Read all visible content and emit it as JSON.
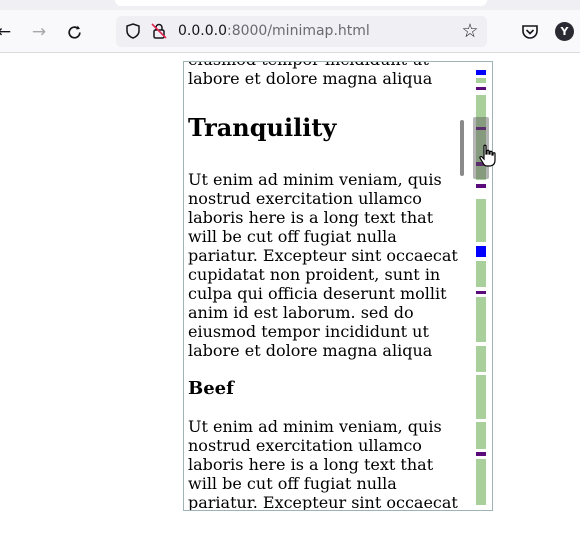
{
  "browser": {
    "url_host": "0.0.0.0",
    "url_rest": ":8000/minimap.html",
    "back_icon": "back-arrow-icon",
    "forward_icon": "forward-arrow-icon",
    "reload_icon": "reload-icon",
    "profile_initial": "Y"
  },
  "content": {
    "para_top_1": "eiusmod tempor incididunt ut",
    "para_top_2": "labore et dolore magna aliqua",
    "heading_1": "Tranquility",
    "para_1": "Ut enim ad minim veniam, quis nostrud exercitation ullamco laboris here is a long text that will be cut off fugiat nulla pariatur. Excepteur sint occaecat cupidatat non proident, sunt in culpa qui officia deserunt mollit anim id est laborum. sed do eiusmod tempor incididunt ut labore et dolore magna aliqua",
    "heading_2": "Beef",
    "para_2": "Ut enim ad minim veniam, quis nostrud exercitation ullamco laboris here is a long text that will be cut off fugiat nulla pariatur. Excepteur sint occaecat"
  },
  "minimap": {
    "colors": {
      "text": "#a9cf9b",
      "heading": "#0000ff",
      "subheading": "#5a0a7a",
      "gap": "#ffffff"
    }
  }
}
